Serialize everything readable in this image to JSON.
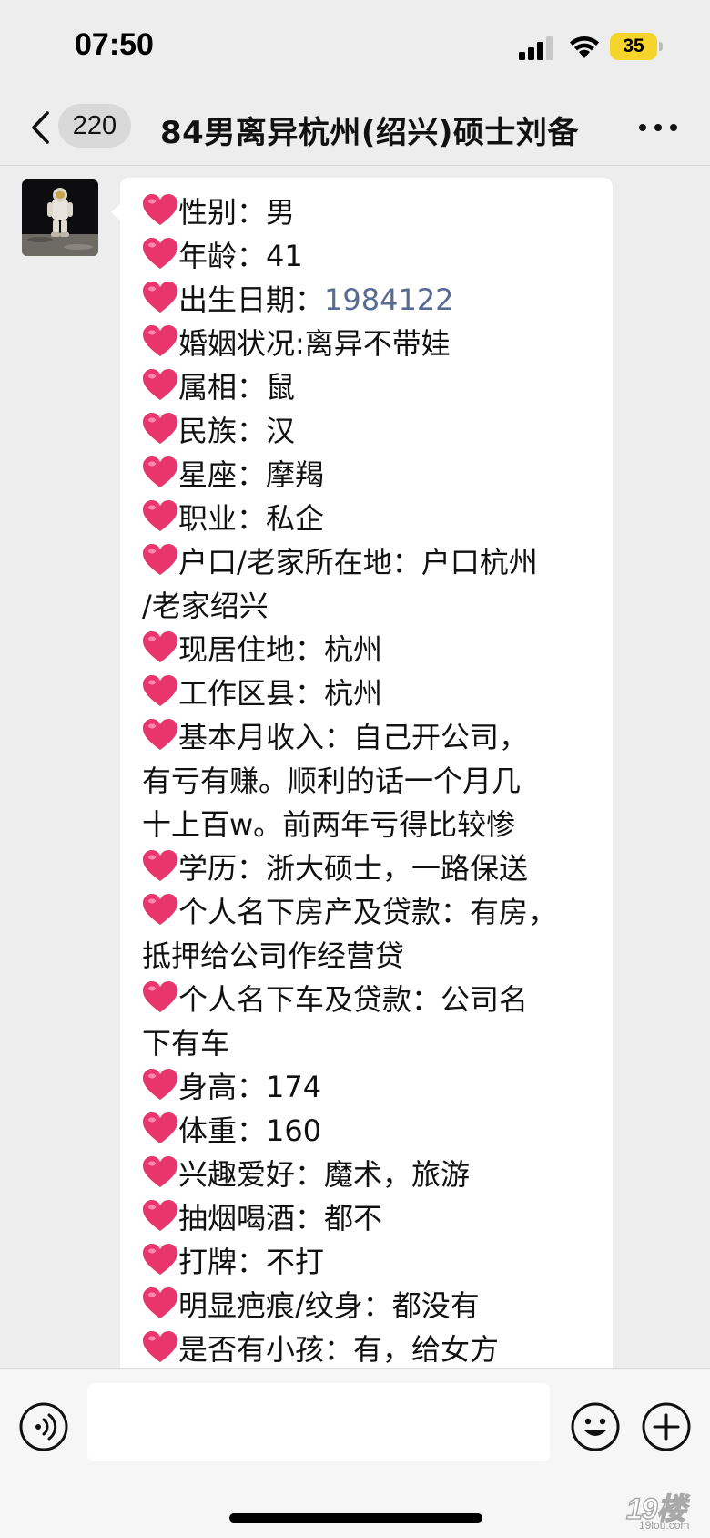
{
  "status_bar": {
    "time": "07:50",
    "battery_level": "35",
    "battery_color": "#f5d52b"
  },
  "nav": {
    "back_icon": "chevron-left-icon",
    "unread_count": "220",
    "title": "84男离异杭州(绍兴)硕士刘备",
    "more_icon": "more-icon"
  },
  "message": {
    "avatar": "astronaut-avatar",
    "heart_icon": "red-heart-emoji",
    "heart_color": "#e8366d",
    "link_color": "#586b94",
    "lines": [
      {
        "heart": true,
        "text": "性别：男"
      },
      {
        "heart": true,
        "text": "年龄：41"
      },
      {
        "heart": true,
        "text": "出生日期：",
        "link": "1984122"
      },
      {
        "heart": true,
        "text": "婚姻状况:离异不带娃"
      },
      {
        "heart": true,
        "text": "属相：鼠"
      },
      {
        "heart": true,
        "text": "民族：汉"
      },
      {
        "heart": true,
        "text": "星座：摩羯"
      },
      {
        "heart": true,
        "text": "职业：私企"
      },
      {
        "heart": true,
        "text": "户口/老家所在地：户口杭州"
      },
      {
        "heart": false,
        "text": "/老家绍兴"
      },
      {
        "heart": true,
        "text": "现居住地：杭州"
      },
      {
        "heart": true,
        "text": "工作区县：杭州"
      },
      {
        "heart": true,
        "text": "基本月收入：自己开公司，"
      },
      {
        "heart": false,
        "text": "有亏有赚。顺利的话一个月几"
      },
      {
        "heart": false,
        "text": "十上百w。前两年亏得比较惨"
      },
      {
        "heart": true,
        "text": "学历：浙大硕士，一路保送"
      },
      {
        "heart": true,
        "text": "个人名下房产及贷款：有房，"
      },
      {
        "heart": false,
        "text": "抵押给公司作经营贷"
      },
      {
        "heart": true,
        "text": "个人名下车及贷款：公司名"
      },
      {
        "heart": false,
        "text": "下有车"
      },
      {
        "heart": true,
        "text": "身高：174"
      },
      {
        "heart": true,
        "text": "体重：160"
      },
      {
        "heart": true,
        "text": "兴趣爱好：魔术，旅游"
      },
      {
        "heart": true,
        "text": "抽烟喝酒：都不"
      },
      {
        "heart": true,
        "text": "打牌：不打"
      },
      {
        "heart": true,
        "text": "明显疤痕/纹身：都没有"
      },
      {
        "heart": true,
        "text": "是否有小孩：有，给女方"
      }
    ]
  },
  "input_bar": {
    "voice_icon": "voice-icon",
    "input_value": "",
    "emoji_icon": "emoji-icon",
    "plus_icon": "plus-icon"
  },
  "watermark": {
    "main": "19楼",
    "sub": "19lou.com"
  }
}
